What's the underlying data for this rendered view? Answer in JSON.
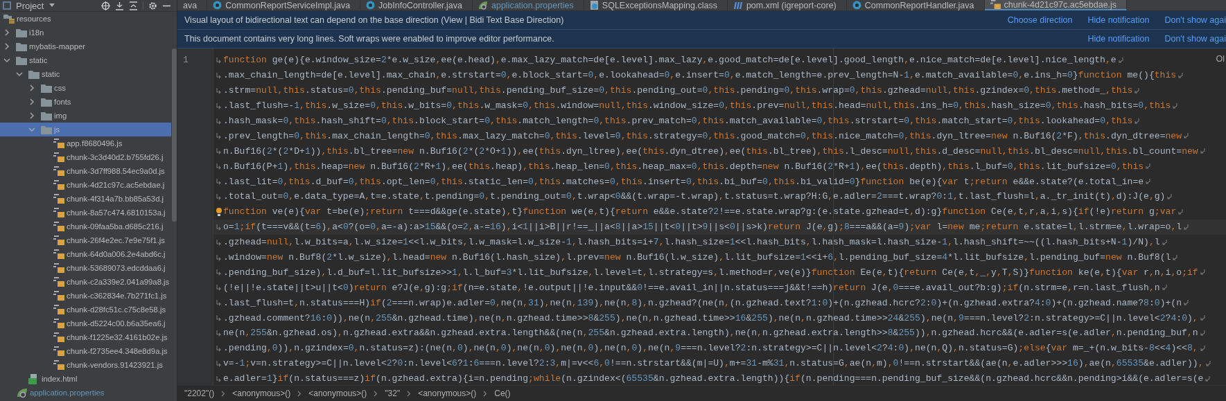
{
  "sidebar": {
    "title": "Project",
    "tree": [
      {
        "label": "resources",
        "kind": "resources",
        "selected": false,
        "modified": false,
        "children": [
          {
            "label": "i18n",
            "kind": "folder",
            "expanded": false,
            "selected": false,
            "modified": false
          },
          {
            "label": "mybatis-mapper",
            "kind": "folder",
            "expanded": false,
            "selected": false,
            "modified": false
          },
          {
            "label": "static",
            "kind": "folder",
            "expanded": true,
            "selected": false,
            "modified": false,
            "children": [
              {
                "label": "static",
                "kind": "folder",
                "expanded": true,
                "selected": false,
                "modified": false,
                "children": [
                  {
                    "label": "css",
                    "kind": "folder",
                    "expanded": false,
                    "selected": false,
                    "modified": false
                  },
                  {
                    "label": "fonts",
                    "kind": "folder",
                    "expanded": false,
                    "selected": false,
                    "modified": false
                  },
                  {
                    "label": "img",
                    "kind": "folder",
                    "expanded": false,
                    "selected": false,
                    "modified": false
                  },
                  {
                    "label": "js",
                    "kind": "folder",
                    "expanded": true,
                    "selected": true,
                    "modified": false,
                    "children": [
                      {
                        "label": "app.f8680496.js",
                        "kind": "js",
                        "selected": false,
                        "modified": false
                      },
                      {
                        "label": "chunk-3c3d40d2.b755fd26.j",
                        "kind": "js",
                        "selected": false,
                        "modified": false
                      },
                      {
                        "label": "chunk-3d7ff988.54ec9a0d.js",
                        "kind": "js",
                        "selected": false,
                        "modified": false
                      },
                      {
                        "label": "chunk-4d21c97c.ac5ebdae.j",
                        "kind": "js",
                        "selected": false,
                        "modified": false
                      },
                      {
                        "label": "chunk-4f314a7b.bb85a53d.j",
                        "kind": "js",
                        "selected": false,
                        "modified": false
                      },
                      {
                        "label": "chunk-8a57c474.6810153a.j",
                        "kind": "js",
                        "selected": false,
                        "modified": false
                      },
                      {
                        "label": "chunk-09faa5ba.d685c216.j",
                        "kind": "js",
                        "selected": false,
                        "modified": false
                      },
                      {
                        "label": "chunk-26f4e2ec.7e9e75f1.js",
                        "kind": "js",
                        "selected": false,
                        "modified": false
                      },
                      {
                        "label": "chunk-64d0a006.2e4abd6c.j",
                        "kind": "js",
                        "selected": false,
                        "modified": false
                      },
                      {
                        "label": "chunk-53689073.edcddaa6.j",
                        "kind": "js",
                        "selected": false,
                        "modified": false
                      },
                      {
                        "label": "chunk-c2a339e2.041a99a8.js",
                        "kind": "js",
                        "selected": false,
                        "modified": false
                      },
                      {
                        "label": "chunk-c362834e.7b271fc1.js",
                        "kind": "js",
                        "selected": false,
                        "modified": false
                      },
                      {
                        "label": "chunk-d28fc51c.c75c8e58.js",
                        "kind": "js",
                        "selected": false,
                        "modified": false
                      },
                      {
                        "label": "chunk-d5224c00.b6a35ea6.j",
                        "kind": "js",
                        "selected": false,
                        "modified": false
                      },
                      {
                        "label": "chunk-f1225e32.4161b02e.js",
                        "kind": "js",
                        "selected": false,
                        "modified": false
                      },
                      {
                        "label": "chunk-f2735ee4.348e8d9a.js",
                        "kind": "js",
                        "selected": false,
                        "modified": false
                      },
                      {
                        "label": "chunk-vendors.91423921.js",
                        "kind": "js",
                        "selected": false,
                        "modified": false
                      }
                    ]
                  }
                ]
              },
              {
                "label": "index.html",
                "kind": "html",
                "selected": false,
                "modified": false
              }
            ]
          },
          {
            "label": "application.properties",
            "kind": "properties",
            "selected": false,
            "modified": true
          }
        ]
      }
    ]
  },
  "tabs": [
    {
      "label": "ava",
      "kind": "none",
      "selected": false,
      "modified": false
    },
    {
      "label": "CommonReportServiceImpl.java",
      "kind": "java",
      "selected": false,
      "modified": false
    },
    {
      "label": "JobInfoController.java",
      "kind": "java",
      "selected": false,
      "modified": false
    },
    {
      "label": "application.properties",
      "kind": "properties",
      "selected": false,
      "modified": true
    },
    {
      "label": "SQLExceptionsMapping.class",
      "kind": "class",
      "selected": false,
      "modified": false
    },
    {
      "label": "pom.xml (igreport-core)",
      "kind": "maven",
      "selected": false,
      "modified": false
    },
    {
      "label": "CommonReportHandler.java",
      "kind": "java",
      "selected": false,
      "modified": false
    },
    {
      "label": "chunk-4d21c97c.ac5ebdae.js",
      "kind": "js",
      "selected": true,
      "modified": false
    }
  ],
  "notifications": [
    {
      "text": "Visual layout of bidirectional text can depend on the base direction (View | Bidi Text Base Direction)",
      "actions": [
        "Choose direction",
        "Hide notification",
        "Don't show agai"
      ]
    },
    {
      "text": "This document contains very long lines. Soft wraps were enabled to improve editor performance.",
      "actions": [
        "Hide notification",
        "Don't show agai"
      ]
    }
  ],
  "editor": {
    "line_number": "1",
    "corner_text": "Ol",
    "lines": [
      {
        "text": "function ge(e){e.window_size=2*e.w_size,ee(e.head),e.max_lazy_match=de[e.level].max_lazy,e.good_match=de[e.level].good_length,e.nice_match=de[e.level].nice_length,e",
        "current": false,
        "bulb": false
      },
      {
        "text": ".max_chain_length=de[e.level].max_chain,e.strstart=0,e.block_start=0,e.lookahead=0,e.insert=0,e.match_length=e.prev_length=N-1,e.match_available=0,e.ins_h=0}function me(){this",
        "current": false,
        "bulb": false
      },
      {
        "text": ".strm=null,this.status=0,this.pending_buf=null,this.pending_buf_size=0,this.pending_out=0,this.pending=0,this.wrap=0,this.gzhead=null,this.gzindex=0,this.method=_,this",
        "current": false,
        "bulb": false
      },
      {
        "text": ".last_flush=-1,this.w_size=0,this.w_bits=0,this.w_mask=0,this.window=null,this.window_size=0,this.prev=null,this.head=null,this.ins_h=0,this.hash_size=0,this.hash_bits=0,this",
        "current": false,
        "bulb": false
      },
      {
        "text": ".hash_mask=0,this.hash_shift=0,this.block_start=0,this.match_length=0,this.prev_match=0,this.match_available=0,this.strstart=0,this.match_start=0,this.lookahead=0,this",
        "current": false,
        "bulb": false
      },
      {
        "text": ".prev_length=0,this.max_chain_length=0,this.max_lazy_match=0,this.level=0,this.strategy=0,this.good_match=0,this.nice_match=0,this.dyn_ltree=new n.Buf16(2*F),this.dyn_dtree=new",
        "current": false,
        "bulb": false
      },
      {
        "text": "n.Buf16(2*(2*D+1)),this.bl_tree=new n.Buf16(2*(2*O+1)),ee(this.dyn_ltree),ee(this.dyn_dtree),ee(this.bl_tree),this.l_desc=null,this.d_desc=null,this.bl_desc=null,this.bl_count=new",
        "current": false,
        "bulb": false
      },
      {
        "text": "n.Buf16(P+1),this.heap=new n.Buf16(2*R+1),ee(this.heap),this.heap_len=0,this.heap_max=0,this.depth=new n.Buf16(2*R+1),ee(this.depth),this.l_buf=0,this.lit_bufsize=0,this",
        "current": false,
        "bulb": false
      },
      {
        "text": ".last_lit=0,this.d_buf=0,this.opt_len=0,this.static_len=0,this.matches=0,this.insert=0,this.bi_buf=0,this.bi_valid=0}function be(e){var t;return e&&e.state?(e.total_in=e",
        "current": false,
        "bulb": false
      },
      {
        "text": ".total_out=0,e.data_type=A,t=e.state,t.pending=0,t.pending_out=0,t.wrap<0&&(t.wrap=-t.wrap),t.status=t.wrap?H:G,e.adler=2===t.wrap?0:1,t.last_flush=l,a._tr_init(t),d):J(e,g)",
        "current": false,
        "bulb": false
      },
      {
        "text": "function ve(e){var t=be(e);return t===d&&ge(e.state),t}function we(e,t){return e&&e.state?2!==e.state.wrap?g:(e.state.gzhead=t,d):g}function Ce(e,t,r,a,i,s){if(!e)return g;var",
        "current": false,
        "bulb": true
      },
      {
        "text": "o=1;if(t===v&&(t=6),a<0?(o=0,a=-a):a>15&&(o=2,a-=16),i<1||i>B||r!==_||a<8||a>15||t<0||t>9||s<0||s>k)return J(e,g);8===a&&(a=9);var l=new me;return e.state=l,l.strm=e,l.wrap=o,l",
        "current": true,
        "bulb": false
      },
      {
        "text": ".gzhead=null,l.w_bits=a,l.w_size=1<<l.w_bits,l.w_mask=l.w_size-1,l.hash_bits=i+7,l.hash_size=1<<l.hash_bits,l.hash_mask=l.hash_size-1,l.hash_shift=~~((l.hash_bits+N-1)/N),l",
        "current": false,
        "bulb": false
      },
      {
        "text": ".window=new n.Buf8(2*l.w_size),l.head=new n.Buf16(l.hash_size),l.prev=new n.Buf16(l.w_size),l.lit_bufsize=1<<i+6,l.pending_buf_size=4*l.lit_bufsize,l.pending_buf=new n.Buf8(l",
        "current": false,
        "bulb": false
      },
      {
        "text": ".pending_buf_size),l.d_buf=l.lit_bufsize>>1,l.l_buf=3*l.lit_bufsize,l.level=t,l.strategy=s,l.method=r,ve(e)}function Ee(e,t){return Ce(e,t,_,y,T,S)}function ke(e,t){var r,n,i,o;if",
        "current": false,
        "bulb": false
      },
      {
        "text": "(!e||!e.state||t>u||t<0)return e?J(e,g):g;if(n=e.state,!e.output||!e.input&&0!==e.avail_in||n.status===j&&t!==h)return J(e,0===e.avail_out?b:g);if(n.strm=e,r=n.last_flush,n",
        "current": false,
        "bulb": false
      },
      {
        "text": ".last_flush=t,n.status===H)if(2===n.wrap)e.adler=0,ne(n,31),ne(n,139),ne(n,8),n.gzhead?(ne(n,(n.gzhead.text?1:0)+(n.gzhead.hcrc?2:0)+(n.gzhead.extra?4:0)+(n.gzhead.name?8:0)+(n",
        "current": false,
        "bulb": false
      },
      {
        "text": ".gzhead.comment?16:0)),ne(n,255&n.gzhead.time),ne(n,n.gzhead.time>>8&255),ne(n,n.gzhead.time>>16&255),ne(n,n.gzhead.time>>24&255),ne(n,9===n.level?2:n.strategy>=C||n.level<2?4:0),",
        "current": false,
        "bulb": false
      },
      {
        "text": "ne(n,255&n.gzhead.os),n.gzhead.extra&&n.gzhead.extra.length&&(ne(n,255&n.gzhead.extra.length),ne(n,n.gzhead.extra.length>>8&255)),n.gzhead.hcrc&&(e.adler=s(e.adler,n.pending_buf,n",
        "current": false,
        "bulb": false
      },
      {
        "text": ".pending,0)),n.gzindex=0,n.status=z):(ne(n,0),ne(n,0),ne(n,0),ne(n,0),ne(n,0),ne(n,9===n.level?2:n.strategy>=C||n.level<2?4:0),ne(n,Q),n.status=G);else{var m=_+(n.w_bits-8<<4)<<8,",
        "current": false,
        "bulb": false
      },
      {
        "text": "v=-1;v=n.strategy>=C||n.level<2?0:n.level<6?1:6===n.level?2:3,m|=v<<6,0!==n.strstart&&(m|=U),m+=31-m%31,n.status=G,ae(n,m),0!==n.strstart&&(ae(n,e.adler>>>16),ae(n,65535&e.adler)),",
        "current": false,
        "bulb": false
      },
      {
        "text": "e.adler=1}if(n.status===z)if(n.gzhead.extra){i=n.pending;while(n.gzindex<(65535&n.gzhead.extra.length)){if(n.pending===n.pending_buf_size&&(n.gzhead.hcrc&&n.pending>i&&(e.adler=s(e",
        "current": false,
        "bulb": false
      }
    ]
  },
  "breadcrumb": [
    "\"2202\"()",
    "<anonymous>()",
    "<anonymous>()",
    "\"32\"",
    "<anonymous>()",
    "Ce()"
  ]
}
